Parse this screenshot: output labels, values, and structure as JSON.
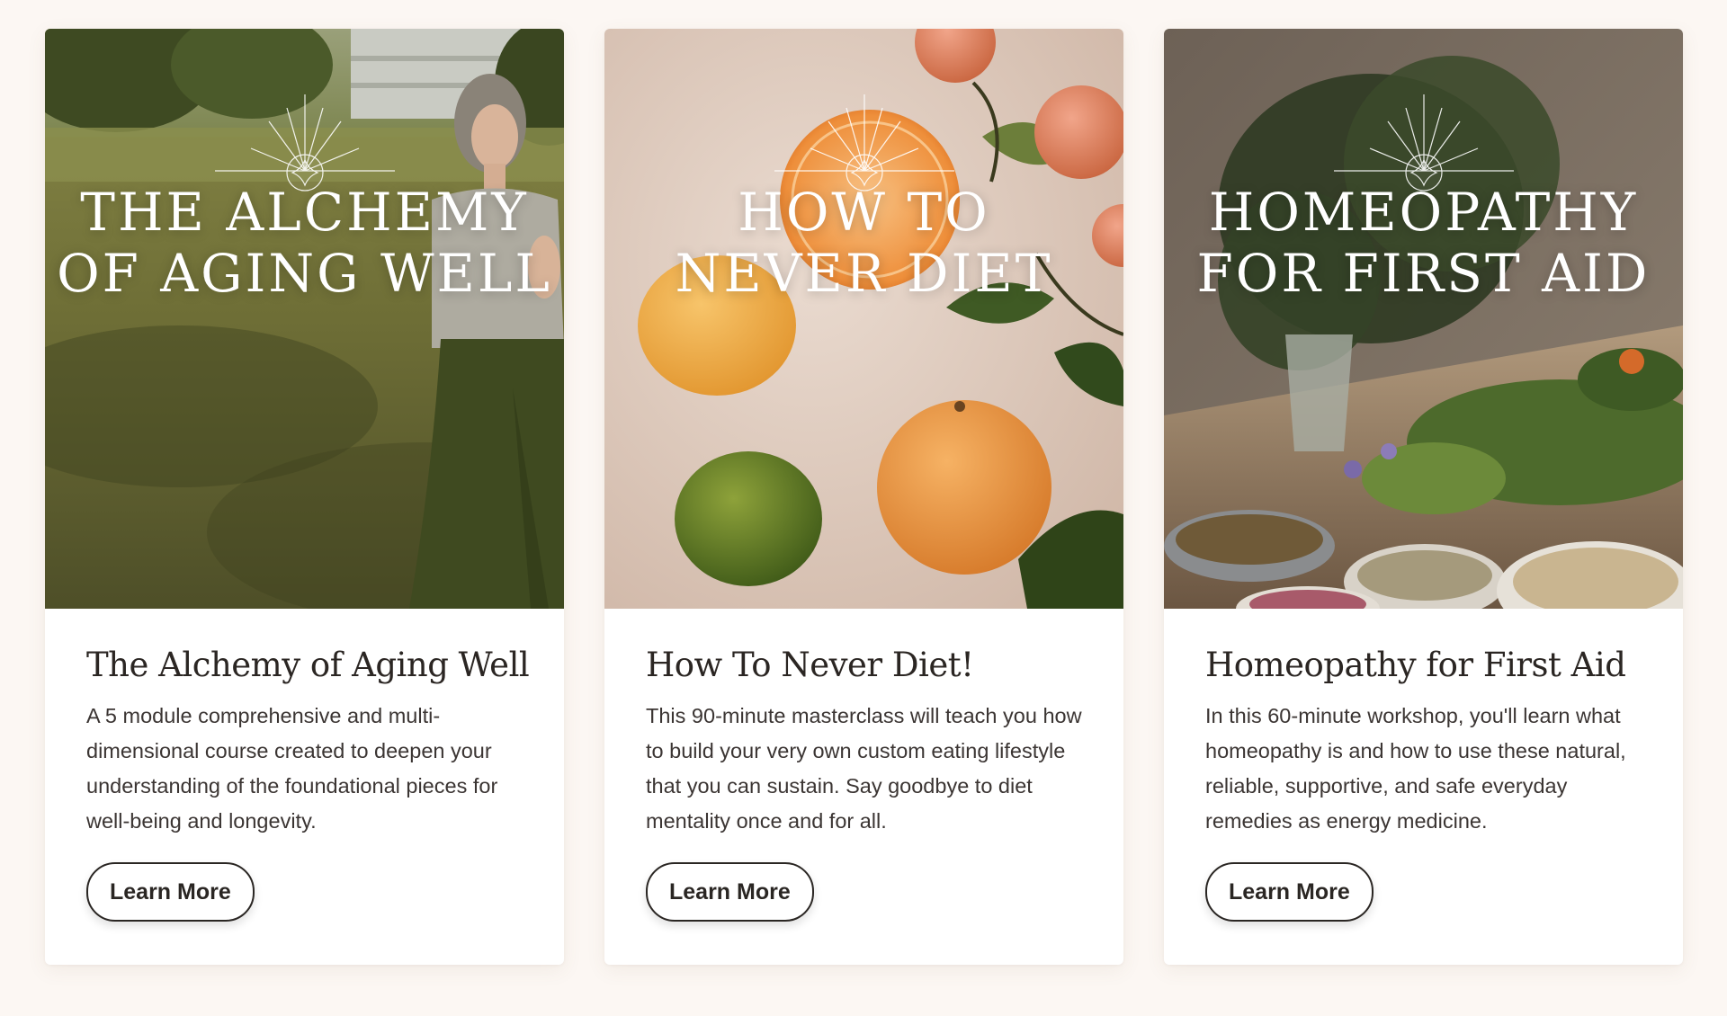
{
  "cards": [
    {
      "image_title_line1": "THE ALCHEMY",
      "image_title_line2": "OF AGING WELL",
      "heading": "The Alchemy of Aging Well",
      "description": "A 5 module comprehensive and multi-dimensional course created to deepen your understanding of the foundational pieces for well-being and longevity.",
      "button_label": "Learn More"
    },
    {
      "image_title_line1": "HOW TO",
      "image_title_line2": "NEVER DIET",
      "heading": "How To Never Diet!",
      "description": "This 90-minute masterclass will teach you how to build your very own custom eating lifestyle that you can sustain. Say goodbye to diet mentality once and for all.",
      "button_label": "Learn More"
    },
    {
      "image_title_line1": "HOMEOPATHY",
      "image_title_line2": "FOR FIRST AID",
      "heading": "Homeopathy for First Aid",
      "description": "In this 60-minute workshop, you'll learn what homeopathy is and how to use these natural, reliable, supportive, and safe everyday remedies as energy medicine.",
      "button_label": "Learn More"
    }
  ],
  "colors": {
    "page_background": "#fcf7f3",
    "card_background": "#ffffff",
    "heading_text": "#2b2623",
    "body_text": "#3b3533",
    "button_border": "#2a2623"
  },
  "icons": {
    "title_ornament": "starburst-diamond-icon"
  }
}
